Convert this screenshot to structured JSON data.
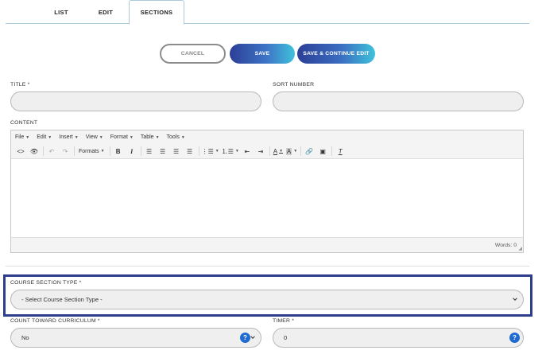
{
  "tabs": {
    "list": "LIST",
    "edit": "EDIT",
    "sections": "SECTIONS"
  },
  "actions": {
    "cancel": "CANCEL",
    "save": "SAVE",
    "save_continue": "SAVE & CONTINUE EDIT"
  },
  "form": {
    "title_label": "TITLE *",
    "sort_label": "SORT NUMBER",
    "content_label": "CONTENT",
    "section_type_label": "COURSE SECTION TYPE *",
    "section_type_value": "- Select Course Section Type -",
    "count_label": "COUNT TOWARD CURRICULUM *",
    "count_value": "No",
    "timer_label": "TIMER *",
    "timer_value": "0"
  },
  "editor": {
    "menus": [
      "File",
      "Edit",
      "Insert",
      "View",
      "Format",
      "Table",
      "Tools"
    ],
    "formats_label": "Formats",
    "word_count": "Words: 0"
  },
  "colors": {
    "accent": "#2c3e8c",
    "help": "#1f6bd1",
    "gradient_start": "#2c3f96",
    "gradient_end": "#3fc2db"
  }
}
